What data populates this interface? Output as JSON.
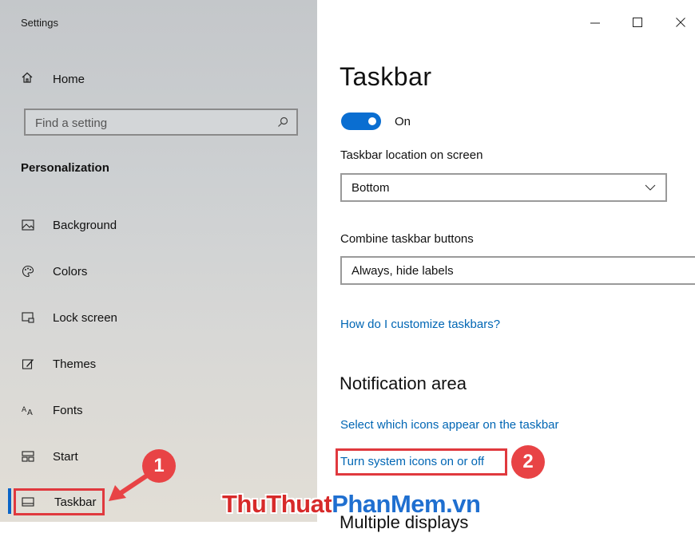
{
  "window": {
    "title": "Settings",
    "controls": [
      "minimize-icon",
      "maximize-icon",
      "close-icon"
    ]
  },
  "sidebar": {
    "home_label": "Home",
    "search_placeholder": "Find a setting",
    "section_heading": "Personalization",
    "items": [
      {
        "label": "Background",
        "icon": "background-icon"
      },
      {
        "label": "Colors",
        "icon": "palette-icon"
      },
      {
        "label": "Lock screen",
        "icon": "lock-screen-icon"
      },
      {
        "label": "Themes",
        "icon": "themes-icon"
      },
      {
        "label": "Fonts",
        "icon": "fonts-icon"
      },
      {
        "label": "Start",
        "icon": "start-icon"
      },
      {
        "label": "Taskbar",
        "icon": "taskbar-icon",
        "selected": true
      }
    ]
  },
  "main": {
    "title": "Taskbar",
    "toggle_state": "On",
    "location_label": "Taskbar location on screen",
    "location_value": "Bottom",
    "combine_label": "Combine taskbar buttons",
    "combine_value": "Always, hide labels",
    "help_link": "How do I customize taskbars?",
    "notification_heading": "Notification area",
    "link_select_icons": "Select which icons appear on the taskbar",
    "link_system_icons": "Turn system icons on or off",
    "next_heading_partial": "Multiple displays"
  },
  "annotations": {
    "badge_1": "1",
    "badge_2": "2",
    "accent_color": "#e84345"
  },
  "watermark": {
    "part1": "ThuThuat",
    "part2": "PhanMem.vn"
  },
  "colors": {
    "accent": "#0a6ed1",
    "link": "#0066b4",
    "selection": "#0a64c8"
  }
}
